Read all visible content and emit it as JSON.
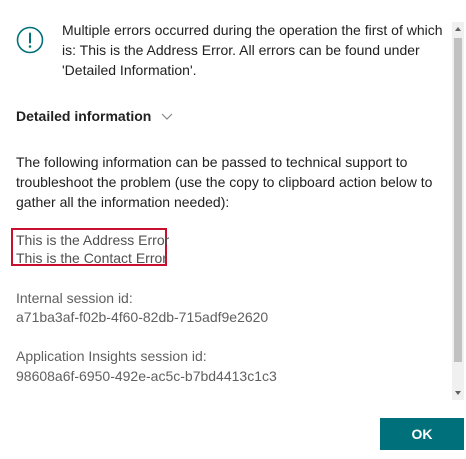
{
  "dialog": {
    "icon": "exclamation-circle-icon",
    "message": "Multiple errors occurred during the operation the first of which is: This is the Address Error. All errors can be found under 'Detailed Information'.",
    "details_toggle_label": "Detailed information",
    "details_toggle_icon": "chevron-down-icon",
    "description": "The following information can be passed to technical support to troubleshoot the problem (use the copy to clipboard action below to gather all the information needed):",
    "errors": [
      "This is the Address Error",
      "This is the Contact Error"
    ],
    "session": {
      "label": "Internal session id:",
      "value": "a71ba3af-f02b-4f60-82db-715adf9e2620"
    },
    "app_insights": {
      "label": "Application Insights session id:",
      "value": "98608a6f-6950-492e-ac5c-b7bd4413c1c3"
    },
    "ok_label": "OK"
  },
  "colors": {
    "accent": "#00707a",
    "highlight_border": "#c8102e"
  }
}
